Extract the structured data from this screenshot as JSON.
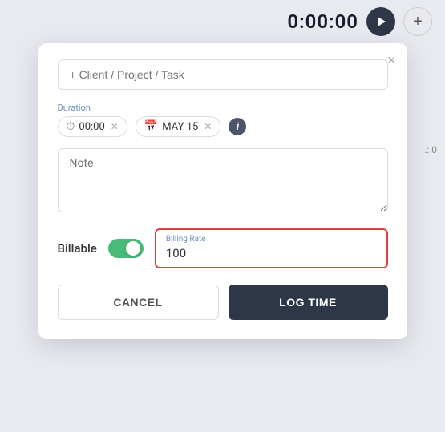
{
  "topbar": {
    "timer": "0:00:00",
    "play_label": "play",
    "plus_label": "add"
  },
  "modal": {
    "close_label": "×",
    "client_placeholder": "+ Client / Project / Task",
    "duration": {
      "label": "Duration",
      "time_value": "00:00",
      "date_value": "MAY 15"
    },
    "note_placeholder": "Note",
    "billable": {
      "label": "Billable",
      "billing_rate_label": "Billing Rate",
      "billing_rate_value": "100"
    },
    "cancel_label": "CANCEL",
    "log_time_label": "LOG TIME"
  },
  "side": {
    "text": ".: 0"
  }
}
